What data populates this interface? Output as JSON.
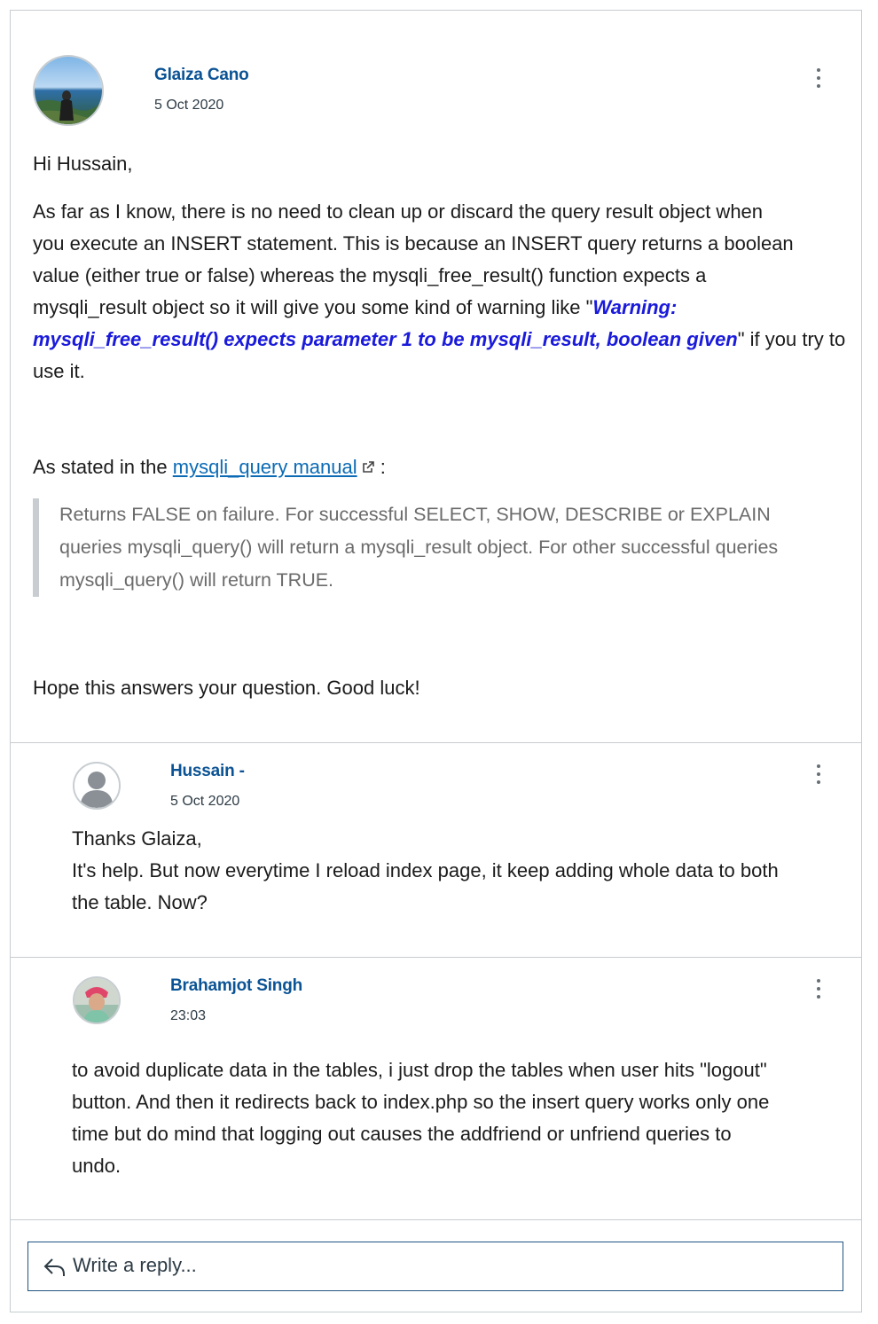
{
  "post": {
    "author": "Glaiza Cano",
    "date": "5 Oct 2020",
    "avatar_icon": "user-photo-avatar",
    "greeting": "Hi Hussain,",
    "body_lines": [
      "As far as I know, there is no need to clean up or discard the query result object when",
      "you execute an INSERT statement. This is because an INSERT query returns a boolean",
      "value (either true or false) whereas the mysqli_free_result() function expects a"
    ],
    "body_line4_prefix": "mysqli_result object so it will give you some kind of warning like \"",
    "warning_part1": "Warning:",
    "warning_part2": "mysqli_free_result() expects parameter 1 to be mysqli_result, boolean given",
    "body_line5_suffix": "\" if you try to",
    "body_line6": "use it.",
    "manual_prefix": "As stated in the ",
    "manual_link": "mysqli_query manual",
    "manual_suffix": " :",
    "quote_lines": [
      "Returns FALSE on failure. For successful SELECT, SHOW, DESCRIBE or EXPLAIN",
      "queries mysqli_query() will return a mysqli_result object. For other successful queries",
      "mysqli_query() will return TRUE."
    ],
    "closing": "Hope this answers your question. Good luck!"
  },
  "replies": [
    {
      "author": "Hussain -",
      "date": "5 Oct 2020",
      "avatar_icon": "default-user-icon",
      "lines": [
        "Thanks Glaiza,",
        "It's help. But now everytime I reload index page, it keep adding whole data to both",
        "the table. Now?"
      ]
    },
    {
      "author": "Brahamjot Singh",
      "date": "23:03",
      "avatar_icon": "user-photo-avatar",
      "lines": [
        "to avoid duplicate data in the tables, i just drop the tables when user hits \"logout\"",
        "button. And then it redirects back to index.php so the insert query works only one",
        "time but do mind that logging out causes the addfriend or unfriend queries to",
        "undo."
      ]
    }
  ],
  "reply_box": {
    "placeholder": "Write a reply...",
    "icon": "reply-arrow-icon"
  },
  "colors": {
    "author": "#0b5394",
    "link": "#0b6bb5",
    "warning": "#1a1adb",
    "border": "#c7cdd1"
  }
}
